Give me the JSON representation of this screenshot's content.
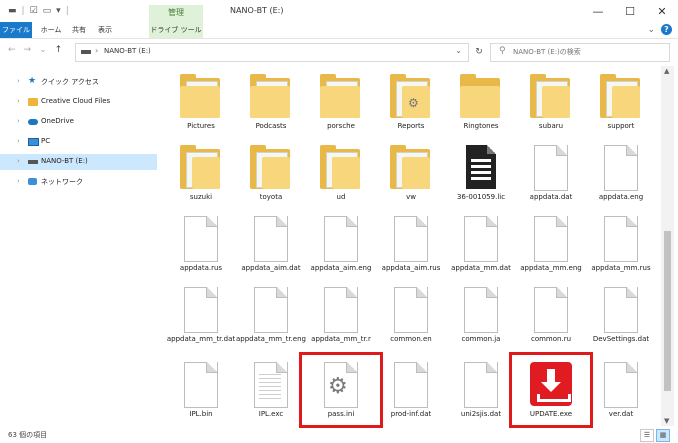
{
  "window": {
    "title": "NANO-BT (E:)",
    "context_group": "管理",
    "controls": {
      "minimize": "—",
      "maximize": "☐",
      "close": "✕"
    }
  },
  "ribbon": {
    "tabs": [
      "ファイル",
      "ホーム",
      "共有",
      "表示",
      "ドライブ ツール"
    ],
    "help_label": "?"
  },
  "address": {
    "path": "NANO-BT (E:)",
    "search_placeholder": "NANO-BT (E:)の検索"
  },
  "sidebar": {
    "items": [
      {
        "label": "クイック アクセス",
        "icon": "star-icon"
      },
      {
        "label": "Creative Cloud Files",
        "icon": "creative-cloud-icon"
      },
      {
        "label": "OneDrive",
        "icon": "cloud-icon"
      },
      {
        "label": "PC",
        "icon": "pc-icon"
      },
      {
        "label": "NANO-BT (E:)",
        "icon": "drive-icon",
        "selected": true
      },
      {
        "label": "ネットワーク",
        "icon": "network-icon"
      }
    ]
  },
  "files": [
    {
      "name": "Pictures",
      "type": "folder"
    },
    {
      "name": "Podcasts",
      "type": "folder"
    },
    {
      "name": "porsche",
      "type": "folder"
    },
    {
      "name": "Reports",
      "type": "folder"
    },
    {
      "name": "Ringtones",
      "type": "folder"
    },
    {
      "name": "subaru",
      "type": "folder"
    },
    {
      "name": "support",
      "type": "folder"
    },
    {
      "name": "suzuki",
      "type": "folder"
    },
    {
      "name": "toyota",
      "type": "folder"
    },
    {
      "name": "ud",
      "type": "folder"
    },
    {
      "name": "vw",
      "type": "folder"
    },
    {
      "name": "36-001059.lic",
      "type": "text"
    },
    {
      "name": "appdata.dat",
      "type": "file"
    },
    {
      "name": "appdata.eng",
      "type": "file"
    },
    {
      "name": "appdata.rus",
      "type": "file"
    },
    {
      "name": "appdata_aim.dat",
      "type": "file"
    },
    {
      "name": "appdata_aim.eng",
      "type": "file"
    },
    {
      "name": "appdata_aim.rus",
      "type": "file"
    },
    {
      "name": "appdata_mm.dat",
      "type": "file"
    },
    {
      "name": "appdata_mm.eng",
      "type": "file"
    },
    {
      "name": "appdata_mm.rus",
      "type": "file"
    },
    {
      "name": "appdata_mm_tr.dat",
      "type": "file"
    },
    {
      "name": "appdata_mm_tr.eng",
      "type": "file"
    },
    {
      "name": "appdata_mm_tr.r",
      "type": "file"
    },
    {
      "name": "common.en",
      "type": "file"
    },
    {
      "name": "common.ja",
      "type": "file"
    },
    {
      "name": "common.ru",
      "type": "file"
    },
    {
      "name": "DevSettings.dat",
      "type": "file"
    },
    {
      "name": "IPL.bin",
      "type": "file"
    },
    {
      "name": "IPL.exc",
      "type": "lines"
    },
    {
      "name": "pass.ini",
      "type": "gear",
      "highlighted": true
    },
    {
      "name": "prod-inf.dat",
      "type": "file"
    },
    {
      "name": "uni2sjis.dat",
      "type": "file"
    },
    {
      "name": "UPDATE.exe",
      "type": "update",
      "highlighted": true
    },
    {
      "name": "ver.dat",
      "type": "file"
    }
  ],
  "status": {
    "item_count": "63 個の項目"
  },
  "colors": {
    "highlight": "#e01a1a",
    "folder": "#f7d67c",
    "selection": "#cce8ff",
    "file_tab": "#1979ca",
    "update_icon": "#e11b22"
  }
}
